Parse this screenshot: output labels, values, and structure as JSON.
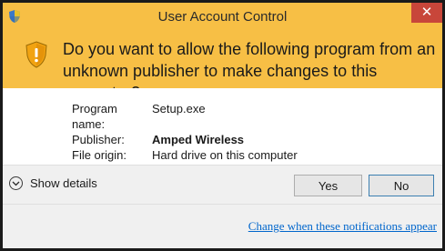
{
  "window": {
    "title": "User Account Control",
    "close_symbol": "✕",
    "icons": {
      "title_icon": "uac-shield-icon",
      "banner_icon": "warning-shield-icon",
      "close_icon": "close-icon",
      "details_icon": "chevron-down-icon"
    },
    "colors": {
      "banner": "#f7bf45",
      "close_button": "#c8463a",
      "link": "#0066cc"
    }
  },
  "banner": {
    "question": "Do you want to allow the following program from an unknown publisher to make changes to this computer?"
  },
  "details": {
    "rows": [
      {
        "label": "Program name:",
        "value": "Setup.exe"
      },
      {
        "label": "Publisher:",
        "value": "Amped Wireless"
      },
      {
        "label": "File origin:",
        "value": "Hard drive on this computer"
      }
    ]
  },
  "footer": {
    "show_details_label": "Show details",
    "yes_label": "Yes",
    "no_label": "No"
  },
  "link": {
    "change_notifications": "Change when these notifications appear"
  }
}
